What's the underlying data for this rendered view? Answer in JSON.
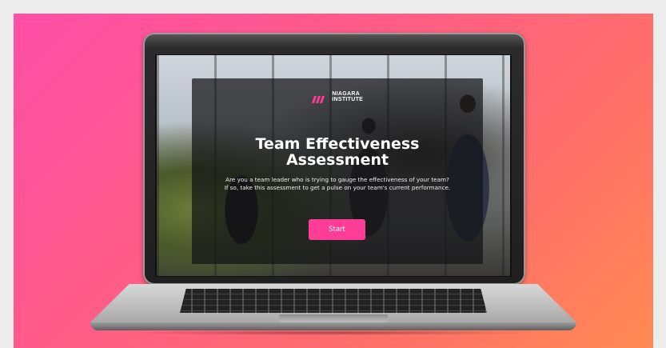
{
  "brand": {
    "logo_line1": "NIAGARA",
    "logo_line2": "INSTITUTE",
    "logo_mark_icon": "niagara-stripes-icon",
    "accent_color": "#ff3d96"
  },
  "hero": {
    "title_line1": "Team Effectiveness",
    "title_line2": "Assessment",
    "description": "Are you a team leader who is trying to gauge the effectiveness of your team? If so, take this assessment to get a pulse on your team's current performance.",
    "start_label": "Start"
  },
  "colors": {
    "gradient_start": "#ff4fa8",
    "gradient_end": "#ff8a52",
    "overlay": "#141416"
  }
}
